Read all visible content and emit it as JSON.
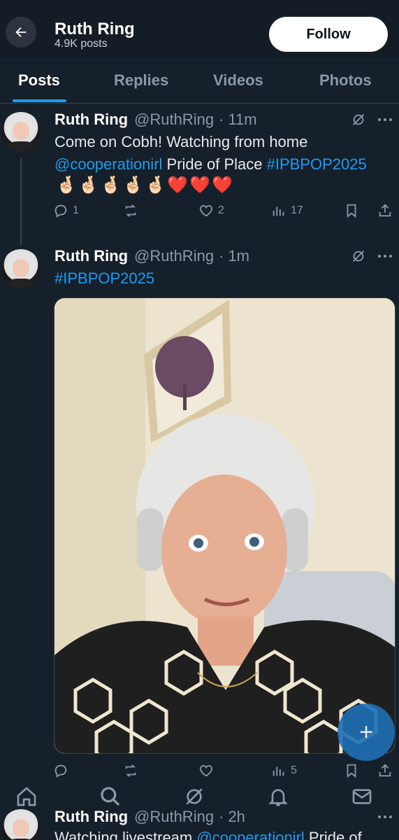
{
  "header": {
    "name": "Ruth Ring",
    "post_count": "4.9K posts",
    "follow_label": "Follow"
  },
  "tabs": [
    {
      "label": "Posts",
      "active": true
    },
    {
      "label": "Replies",
      "active": false
    },
    {
      "label": "Videos",
      "active": false
    },
    {
      "label": "Photos",
      "active": false
    }
  ],
  "tweets": [
    {
      "name": "Ruth Ring",
      "handle": "@RuthRing",
      "time": "· 11m",
      "line1": "Come on Cobh! Watching from home",
      "mention": "@cooperationirl",
      "line2_middle": " Pride of Place ",
      "hashtag": "#IPBPOP2025",
      "emojis": "🤞🏻🤞🏻🤞🏻🤞🏻🤞🏻❤️❤️❤️",
      "replies": "1",
      "reposts": "",
      "likes": "2",
      "views": "17"
    },
    {
      "name": "Ruth Ring",
      "handle": "@RuthRing",
      "time": "· 1m",
      "hashtag": "#IPBPOP2025",
      "replies": "",
      "reposts": "",
      "likes": "",
      "views": "5"
    },
    {
      "name": "Ruth Ring",
      "handle": "@RuthRing",
      "time": "· 2h",
      "text_start": "Watching livestream ",
      "mention": "@cooperationirl",
      "text_end": " Pride of"
    }
  ],
  "icons": {
    "back": "arrow-left-icon",
    "grok": "grok-icon",
    "more": "more-icon",
    "reply": "reply-icon",
    "repost": "repost-icon",
    "like": "heart-icon",
    "views": "views-icon",
    "bookmark": "bookmark-icon",
    "share": "share-icon",
    "home": "home-icon",
    "search": "search-icon",
    "grok_nav": "grok-nav-icon",
    "notifications": "bell-icon",
    "messages": "mail-icon",
    "compose": "compose-icon"
  },
  "colors": {
    "background": "#15202b",
    "accent": "#1d9bf0",
    "text_secondary": "#8b98a5"
  }
}
